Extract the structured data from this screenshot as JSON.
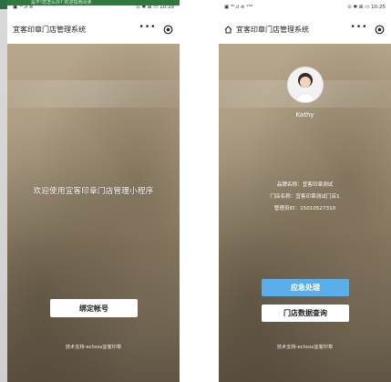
{
  "left_screen": {
    "banner_text": "是不!您怎么办? 欢迎指南阅读",
    "status_left": "▣ ⁴⁶.ıl ≋",
    "status_right": "⊙ ✱ ⊠ ▭ 10:39",
    "app_title": "宜客印章门店管理系统",
    "welcome_text": "欢迎使用宜客印章门店管理小程序",
    "bind_button": "绑定帐号",
    "support_text": "技术支持-echoss宜客印章"
  },
  "right_screen": {
    "status_left": "▣ ⁴⁶.ıl ≋ ¹⁵⁸",
    "status_right": "⊙ ✱ ⊠ ▭ 10:25",
    "app_title": "宜客印章门店管理系统",
    "username": "Kathy",
    "brand_line": "品牌名称：宜客印章测试",
    "store_line": "门店名称：宜客印章测试门店1",
    "manager_line": "管理员ID：15010527310",
    "emergency_button": "应急处理",
    "store_query_button": "门店数据查询",
    "support_text": "技术支持-echoss宜客印章"
  },
  "icons": {
    "more": "more-dots-icon",
    "target": "target-icon",
    "home": "home-icon"
  },
  "colors": {
    "primary_button": "#5aaee9",
    "banner": "#2e7a3c"
  }
}
